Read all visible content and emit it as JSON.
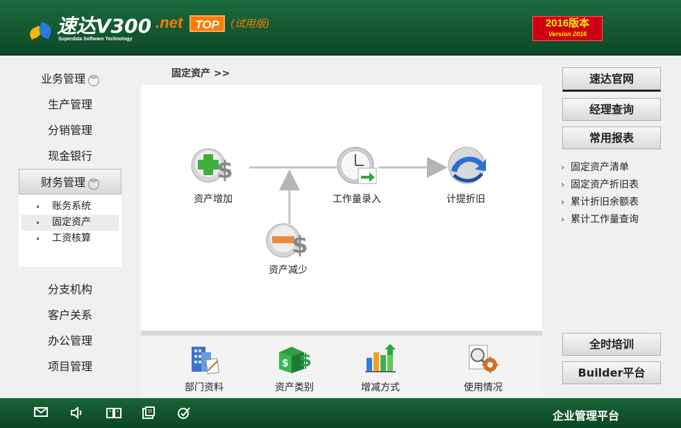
{
  "header": {
    "logo_name": "速达V300",
    "logo_sub": "Superdata Software Technology",
    "logo_net": ".net",
    "logo_top": "TOP",
    "logo_trial": "(试用版)",
    "version_line1": "2016版本",
    "version_line2": "Version 2016",
    "brand_green": "#1c6a3d",
    "accent_orange": "#ff7a00",
    "badge_red": "#d00014"
  },
  "left_nav": {
    "upper_items": [
      {
        "label": "业务管理",
        "expandable": true
      },
      {
        "label": "生产管理"
      },
      {
        "label": "分销管理"
      },
      {
        "label": "现金银行"
      }
    ],
    "active_item": {
      "label": "财务管理",
      "expandable": true
    },
    "sub_items": [
      {
        "label": "账务系统"
      },
      {
        "label": "固定资产",
        "selected": true
      },
      {
        "label": "工资核算"
      }
    ],
    "lower_items": [
      {
        "label": "分支机构"
      },
      {
        "label": "客户关系"
      },
      {
        "label": "办公管理"
      },
      {
        "label": "项目管理"
      }
    ]
  },
  "breadcrumb": "固定资产  >>",
  "flow": {
    "nodes": {
      "asset_add": "资产增加",
      "asset_reduce": "资产减少",
      "workload_entry": "工作量录入",
      "depreciation": "计提折旧"
    }
  },
  "tools": [
    {
      "label": "部门资料",
      "icon": "building-icon"
    },
    {
      "label": "资产类别",
      "icon": "money-box-icon"
    },
    {
      "label": "增减方式",
      "icon": "bar-chart-icon"
    },
    {
      "label": "使用情况",
      "icon": "gear-search-icon"
    }
  ],
  "right_panel": {
    "buttons_top": [
      "速达官网",
      "经理查询",
      "常用报表"
    ],
    "reports": [
      "固定资产清单",
      "固定资产折旧表",
      "累计折旧余额表",
      "累计工作量查询"
    ],
    "buttons_bottom": [
      "全时培训",
      "Builder平台"
    ]
  },
  "footer": {
    "icons": [
      "mail-icon",
      "speaker-icon",
      "book-icon",
      "clipboard-icon",
      "check-circle-icon"
    ],
    "title": "企业管理平台"
  }
}
